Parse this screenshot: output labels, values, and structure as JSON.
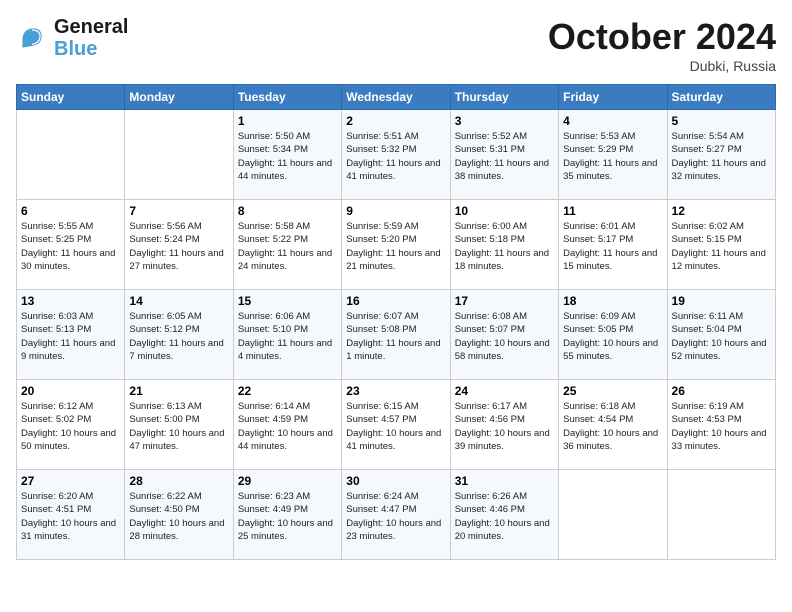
{
  "header": {
    "logo_line1": "General",
    "logo_line2": "Blue",
    "month": "October 2024",
    "location": "Dubki, Russia"
  },
  "weekdays": [
    "Sunday",
    "Monday",
    "Tuesday",
    "Wednesday",
    "Thursday",
    "Friday",
    "Saturday"
  ],
  "weeks": [
    [
      {
        "day": "",
        "info": ""
      },
      {
        "day": "",
        "info": ""
      },
      {
        "day": "1",
        "info": "Sunrise: 5:50 AM\nSunset: 5:34 PM\nDaylight: 11 hours and 44 minutes."
      },
      {
        "day": "2",
        "info": "Sunrise: 5:51 AM\nSunset: 5:32 PM\nDaylight: 11 hours and 41 minutes."
      },
      {
        "day": "3",
        "info": "Sunrise: 5:52 AM\nSunset: 5:31 PM\nDaylight: 11 hours and 38 minutes."
      },
      {
        "day": "4",
        "info": "Sunrise: 5:53 AM\nSunset: 5:29 PM\nDaylight: 11 hours and 35 minutes."
      },
      {
        "day": "5",
        "info": "Sunrise: 5:54 AM\nSunset: 5:27 PM\nDaylight: 11 hours and 32 minutes."
      }
    ],
    [
      {
        "day": "6",
        "info": "Sunrise: 5:55 AM\nSunset: 5:25 PM\nDaylight: 11 hours and 30 minutes."
      },
      {
        "day": "7",
        "info": "Sunrise: 5:56 AM\nSunset: 5:24 PM\nDaylight: 11 hours and 27 minutes."
      },
      {
        "day": "8",
        "info": "Sunrise: 5:58 AM\nSunset: 5:22 PM\nDaylight: 11 hours and 24 minutes."
      },
      {
        "day": "9",
        "info": "Sunrise: 5:59 AM\nSunset: 5:20 PM\nDaylight: 11 hours and 21 minutes."
      },
      {
        "day": "10",
        "info": "Sunrise: 6:00 AM\nSunset: 5:18 PM\nDaylight: 11 hours and 18 minutes."
      },
      {
        "day": "11",
        "info": "Sunrise: 6:01 AM\nSunset: 5:17 PM\nDaylight: 11 hours and 15 minutes."
      },
      {
        "day": "12",
        "info": "Sunrise: 6:02 AM\nSunset: 5:15 PM\nDaylight: 11 hours and 12 minutes."
      }
    ],
    [
      {
        "day": "13",
        "info": "Sunrise: 6:03 AM\nSunset: 5:13 PM\nDaylight: 11 hours and 9 minutes."
      },
      {
        "day": "14",
        "info": "Sunrise: 6:05 AM\nSunset: 5:12 PM\nDaylight: 11 hours and 7 minutes."
      },
      {
        "day": "15",
        "info": "Sunrise: 6:06 AM\nSunset: 5:10 PM\nDaylight: 11 hours and 4 minutes."
      },
      {
        "day": "16",
        "info": "Sunrise: 6:07 AM\nSunset: 5:08 PM\nDaylight: 11 hours and 1 minute."
      },
      {
        "day": "17",
        "info": "Sunrise: 6:08 AM\nSunset: 5:07 PM\nDaylight: 10 hours and 58 minutes."
      },
      {
        "day": "18",
        "info": "Sunrise: 6:09 AM\nSunset: 5:05 PM\nDaylight: 10 hours and 55 minutes."
      },
      {
        "day": "19",
        "info": "Sunrise: 6:11 AM\nSunset: 5:04 PM\nDaylight: 10 hours and 52 minutes."
      }
    ],
    [
      {
        "day": "20",
        "info": "Sunrise: 6:12 AM\nSunset: 5:02 PM\nDaylight: 10 hours and 50 minutes."
      },
      {
        "day": "21",
        "info": "Sunrise: 6:13 AM\nSunset: 5:00 PM\nDaylight: 10 hours and 47 minutes."
      },
      {
        "day": "22",
        "info": "Sunrise: 6:14 AM\nSunset: 4:59 PM\nDaylight: 10 hours and 44 minutes."
      },
      {
        "day": "23",
        "info": "Sunrise: 6:15 AM\nSunset: 4:57 PM\nDaylight: 10 hours and 41 minutes."
      },
      {
        "day": "24",
        "info": "Sunrise: 6:17 AM\nSunset: 4:56 PM\nDaylight: 10 hours and 39 minutes."
      },
      {
        "day": "25",
        "info": "Sunrise: 6:18 AM\nSunset: 4:54 PM\nDaylight: 10 hours and 36 minutes."
      },
      {
        "day": "26",
        "info": "Sunrise: 6:19 AM\nSunset: 4:53 PM\nDaylight: 10 hours and 33 minutes."
      }
    ],
    [
      {
        "day": "27",
        "info": "Sunrise: 6:20 AM\nSunset: 4:51 PM\nDaylight: 10 hours and 31 minutes."
      },
      {
        "day": "28",
        "info": "Sunrise: 6:22 AM\nSunset: 4:50 PM\nDaylight: 10 hours and 28 minutes."
      },
      {
        "day": "29",
        "info": "Sunrise: 6:23 AM\nSunset: 4:49 PM\nDaylight: 10 hours and 25 minutes."
      },
      {
        "day": "30",
        "info": "Sunrise: 6:24 AM\nSunset: 4:47 PM\nDaylight: 10 hours and 23 minutes."
      },
      {
        "day": "31",
        "info": "Sunrise: 6:26 AM\nSunset: 4:46 PM\nDaylight: 10 hours and 20 minutes."
      },
      {
        "day": "",
        "info": ""
      },
      {
        "day": "",
        "info": ""
      }
    ]
  ]
}
